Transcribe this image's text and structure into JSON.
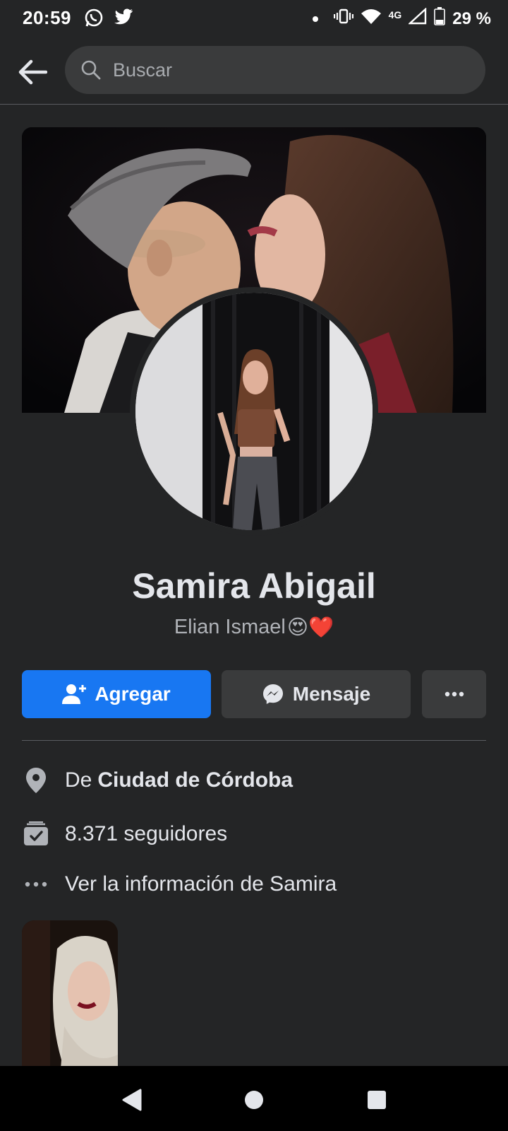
{
  "status_bar": {
    "time": "20:59",
    "apps": [
      "whatsapp-icon",
      "twitter-icon"
    ],
    "network": "4G",
    "battery": "29 %"
  },
  "search": {
    "placeholder": "Buscar"
  },
  "profile": {
    "name": "Samira Abigail",
    "bio_text": "Elian Ismael",
    "bio_emojis": "😍❤️"
  },
  "actions": {
    "add_label": "Agregar",
    "message_label": "Mensaje"
  },
  "info": {
    "location_prefix": "De",
    "location": "Ciudad de Córdoba",
    "followers": "8.371 seguidores",
    "more_info": "Ver la información de Samira"
  },
  "colors": {
    "background": "#242526",
    "primary": "#1877f2",
    "secondary_button": "#3a3b3c"
  }
}
